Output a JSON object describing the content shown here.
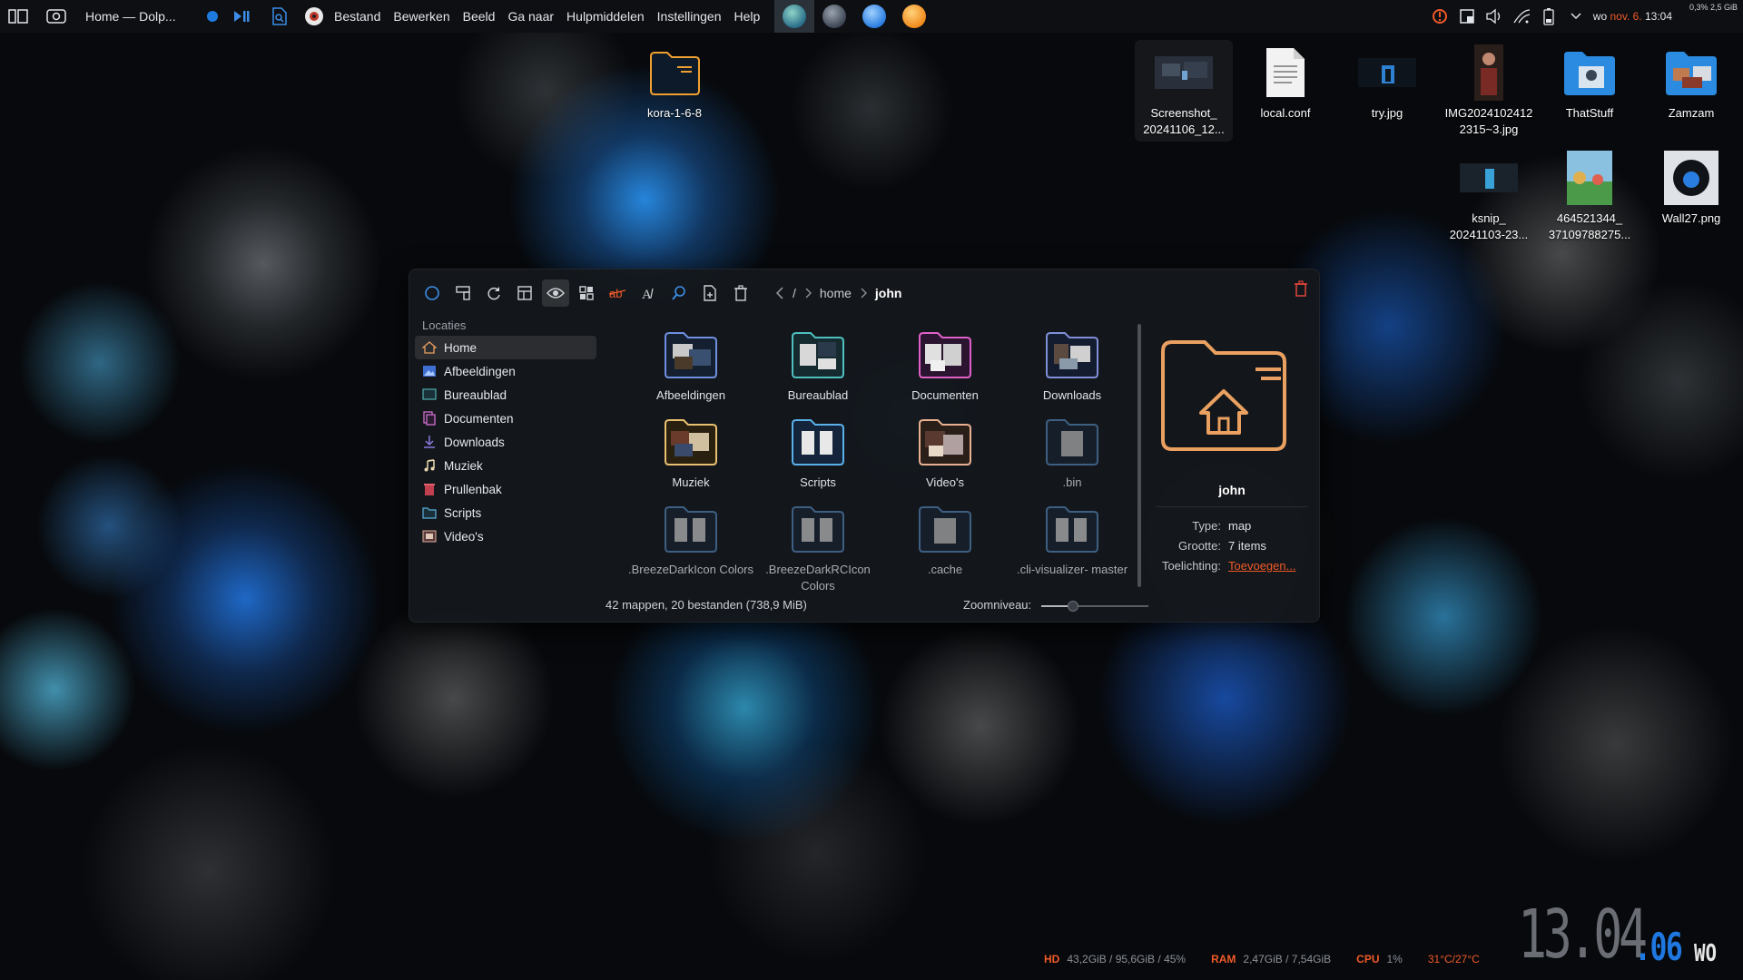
{
  "panel": {
    "window_title": "Home — Dolp...",
    "menu": [
      "Bestand",
      "Bewerken",
      "Beeld",
      "Ga naar",
      "Hulpmiddelen",
      "Instellingen",
      "Help"
    ],
    "clock": {
      "day": "wo",
      "date": "nov. 6.",
      "time": "13:04"
    },
    "stats": [
      "0,3%",
      "2,5 GiB"
    ],
    "accent_color": "#f05a28"
  },
  "desktop": {
    "icons": [
      {
        "label": "kora-1-6-8",
        "kind": "folder-icon"
      },
      {
        "label": "Screenshot_ 20241106_12...",
        "kind": "image-icon"
      },
      {
        "label": "local.conf",
        "kind": "text-file-icon"
      },
      {
        "label": "try.jpg",
        "kind": "image-icon"
      },
      {
        "label": "IMG2024102412 2315~3.jpg",
        "kind": "image-icon"
      },
      {
        "label": "ThatStuff",
        "kind": "folder-icon"
      },
      {
        "label": "Zamzam",
        "kind": "folder-icon"
      },
      {
        "label": "ksnip_ 20241103-23...",
        "kind": "image-icon"
      },
      {
        "label": "464521344_ 37109788275...",
        "kind": "image-icon"
      },
      {
        "label": "Wall27.png",
        "kind": "image-icon"
      }
    ]
  },
  "dolphin": {
    "breadcrumb": [
      "/",
      "home",
      "john"
    ],
    "sidebar": {
      "heading": "Locaties",
      "items": [
        "Home",
        "Afbeeldingen",
        "Bureaublad",
        "Documenten",
        "Downloads",
        "Muziek",
        "Prullenbak",
        "Scripts",
        "Video's"
      ],
      "selected": "Home"
    },
    "files": [
      {
        "name": "Afbeeldingen",
        "hidden": false
      },
      {
        "name": "Bureaublad",
        "hidden": false
      },
      {
        "name": "Documenten",
        "hidden": false
      },
      {
        "name": "Downloads",
        "hidden": false
      },
      {
        "name": "Muziek",
        "hidden": false
      },
      {
        "name": "Scripts",
        "hidden": false
      },
      {
        "name": "Video's",
        "hidden": false
      },
      {
        "name": ".bin",
        "hidden": true
      },
      {
        "name": ".BreezeDarkIcon Colors",
        "hidden": true
      },
      {
        "name": ".BreezeDarkRCIcon Colors",
        "hidden": true
      },
      {
        "name": ".cache",
        "hidden": true
      },
      {
        "name": ".cli-visualizer- master",
        "hidden": true
      }
    ],
    "info": {
      "name": "john",
      "type_label": "Type:",
      "type_value": "map",
      "size_label": "Grootte:",
      "size_value": "7 items",
      "comment_label": "Toelichting:",
      "comment_value": "Toevoegen..."
    },
    "status": "42 mappen, 20 bestanden (738,9 MiB)",
    "zoom_label": "Zoomniveau:",
    "zoom_level": 0.3
  },
  "sysmon": {
    "hd_label": "HD",
    "hd_value": "43,2GiB / 95,6GiB / 45%",
    "ram_label": "RAM",
    "ram_value": "2,47GiB / 7,54GiB",
    "cpu_label": "CPU",
    "cpu_value": "1%",
    "temp": "31°C/27°C"
  },
  "bigclock": {
    "hm": "13.04",
    "day": ".06",
    "dow": "WO"
  }
}
